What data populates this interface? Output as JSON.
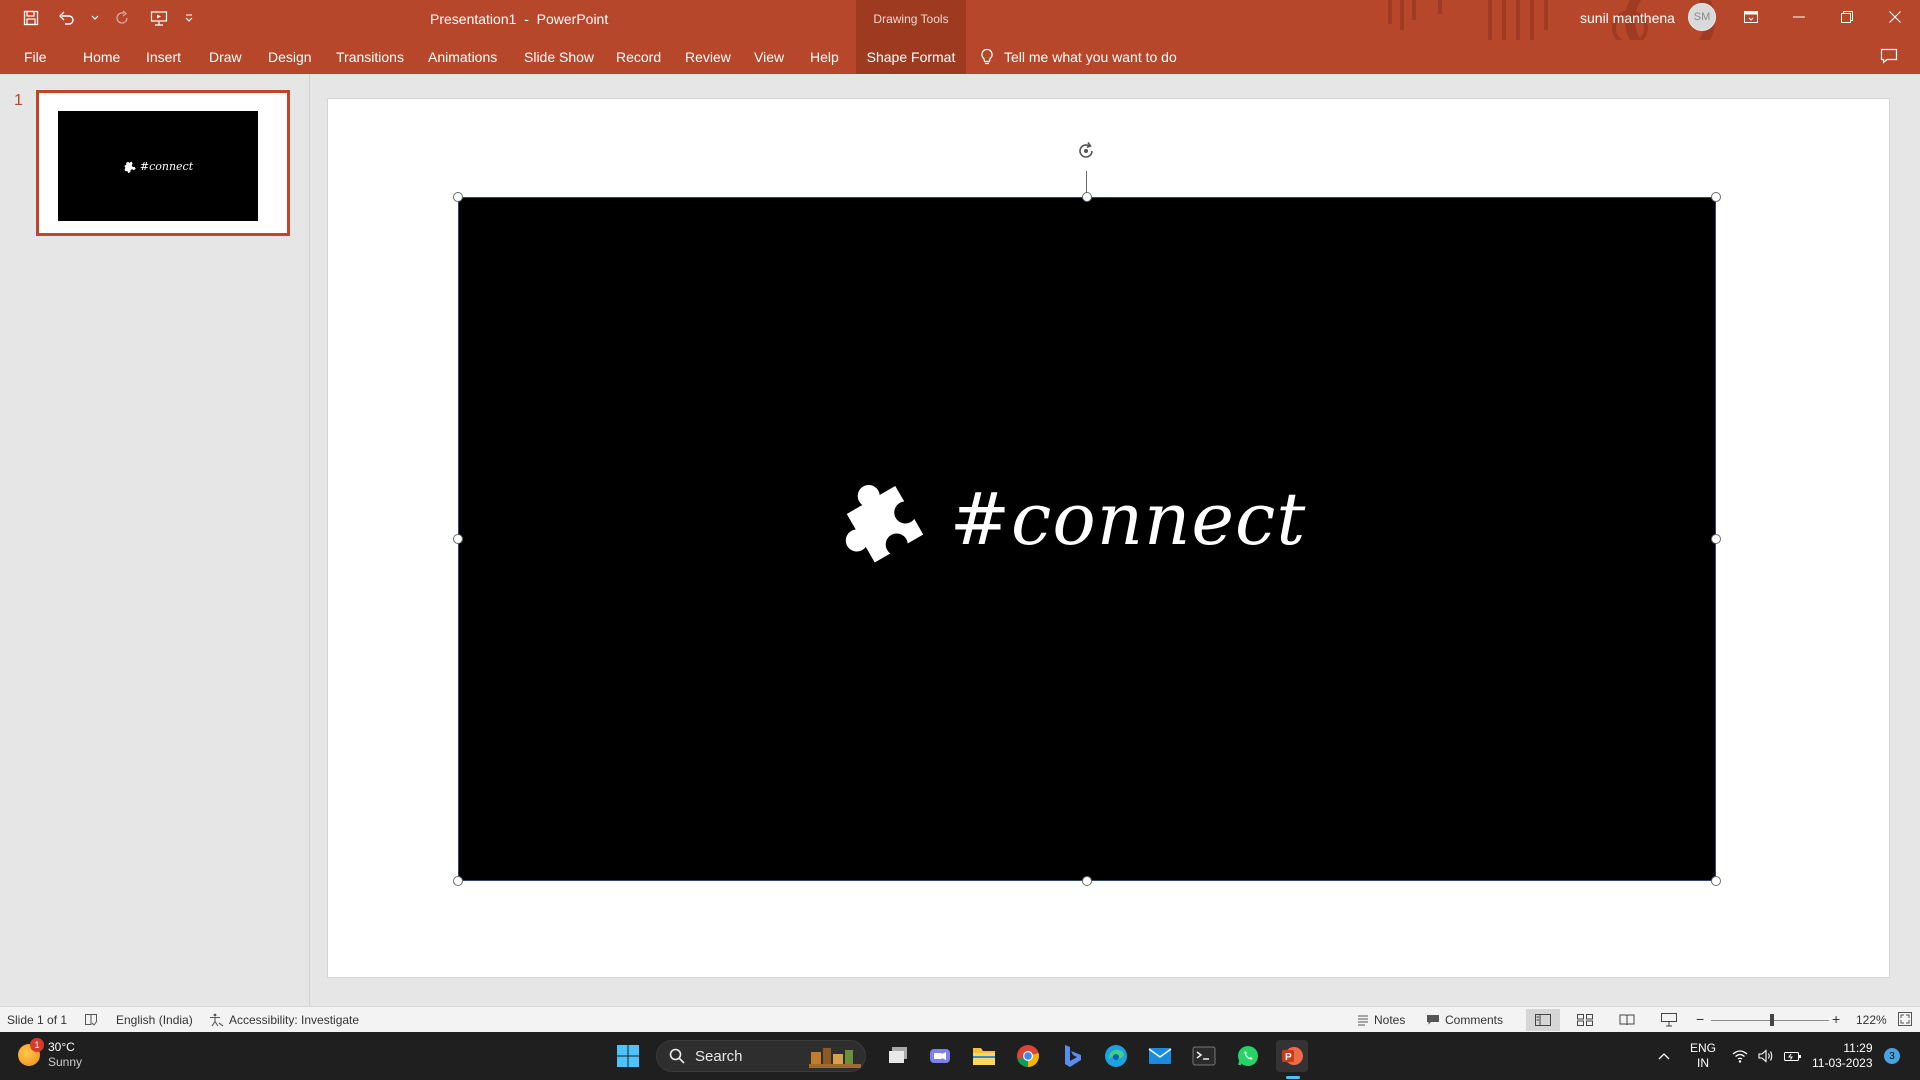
{
  "titlebar": {
    "document_name": "Presentation1",
    "separator": "-",
    "app_name": "PowerPoint",
    "contextual_group": "Drawing Tools",
    "user_name": "sunil manthena",
    "user_initials": "SM",
    "background_color": "#b7472a"
  },
  "ribbon": {
    "tabs": [
      {
        "label": "File"
      },
      {
        "label": "Home"
      },
      {
        "label": "Insert"
      },
      {
        "label": "Draw"
      },
      {
        "label": "Design"
      },
      {
        "label": "Transitions"
      },
      {
        "label": "Animations"
      },
      {
        "label": "Slide Show"
      },
      {
        "label": "Record"
      },
      {
        "label": "Review"
      },
      {
        "label": "View"
      },
      {
        "label": "Help"
      },
      {
        "label": "Shape Format",
        "active": true
      }
    ],
    "tell_me_placeholder": "Tell me what you want to do"
  },
  "thumbnails": [
    {
      "number": "1",
      "text": "#connect",
      "selected": true
    }
  ],
  "slide": {
    "text": "#connect",
    "icon": "puzzle-piece-icon",
    "shape_fill": "#000000",
    "text_color": "#ffffff"
  },
  "statusbar": {
    "slide_info": "Slide 1 of 1",
    "language": "English (India)",
    "accessibility": "Accessibility: Investigate",
    "notes": "Notes",
    "comments": "Comments",
    "zoom": "122%",
    "zoom_minus": "−",
    "zoom_plus": "+"
  },
  "taskbar": {
    "weather_temp": "30°C",
    "weather_desc": "Sunny",
    "weather_badge": "1",
    "search_label": "Search",
    "apps": [
      "windows-start-icon",
      "search-icon",
      "widgets-icon",
      "task-view-icon",
      "teams-icon",
      "file-explorer-icon",
      "chrome-icon",
      "bing-icon",
      "edge-icon",
      "mail-icon",
      "terminal-icon",
      "whatsapp-icon",
      "powerpoint-icon"
    ],
    "lang_top": "ENG",
    "lang_bottom": "IN",
    "time": "11:29",
    "date": "11-03-2023",
    "notification_count": "3"
  }
}
